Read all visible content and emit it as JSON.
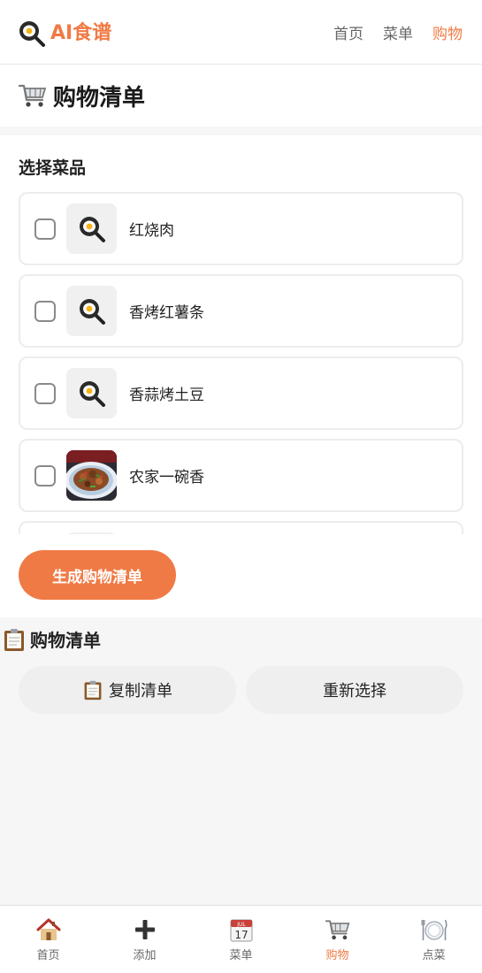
{
  "header": {
    "brand": "AI食谱",
    "brand_icon": "frying-pan-egg-icon",
    "nav": [
      {
        "label": "首页",
        "active": false
      },
      {
        "label": "菜单",
        "active": false
      },
      {
        "label": "购物",
        "active": true
      }
    ]
  },
  "page": {
    "title": "购物清单",
    "title_icon": "shopping-cart-icon"
  },
  "select": {
    "label": "选择菜品",
    "dishes": [
      {
        "name": "红烧肉",
        "checked": false,
        "thumb": "frying-pan-egg-icon"
      },
      {
        "name": "香烤红薯条",
        "checked": false,
        "thumb": "frying-pan-egg-icon"
      },
      {
        "name": "香蒜烤土豆",
        "checked": false,
        "thumb": "frying-pan-egg-icon"
      },
      {
        "name": "农家一碗香",
        "checked": false,
        "thumb": "dish-photo"
      }
    ],
    "generate_label": "生成购物清单"
  },
  "list": {
    "title": "购物清单",
    "title_icon": "clipboard-icon",
    "copy_label": "复制清单",
    "reset_label": "重新选择"
  },
  "tabs": [
    {
      "label": "首页",
      "icon": "house-icon",
      "active": false
    },
    {
      "label": "添加",
      "icon": "plus-icon",
      "active": false
    },
    {
      "label": "菜单",
      "icon": "calendar-icon",
      "active": false
    },
    {
      "label": "购物",
      "icon": "shopping-cart-icon",
      "active": true
    },
    {
      "label": "点菜",
      "icon": "plate-cutlery-icon",
      "active": false
    }
  ],
  "colors": {
    "accent": "#f07a45",
    "text": "#222222",
    "muted": "#666666",
    "background": "#f6f6f6"
  }
}
